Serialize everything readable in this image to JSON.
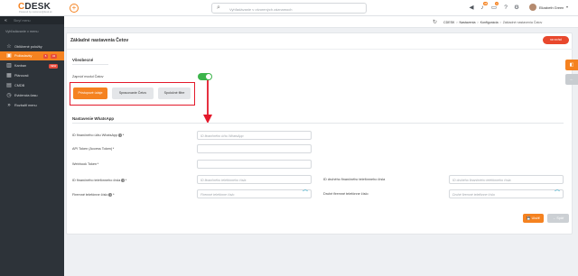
{
  "header": {
    "logo_text": "DESK",
    "logo_c": "C",
    "logo_sub": "Powered by customer@desk.sk",
    "plus_glyph": "+",
    "search_placeholder": "Vyhľadávanie v otvorených záznamoch",
    "icons": [
      {
        "name": "megaphone-icon",
        "glyph": "📢",
        "badge": ""
      },
      {
        "name": "bell-icon",
        "glyph": "🔔",
        "badge": "38"
      },
      {
        "name": "chat-icon",
        "glyph": "💬",
        "badge": "4"
      },
      {
        "name": "question-icon",
        "glyph": "?",
        "badge": ""
      },
      {
        "name": "gear-icon",
        "glyph": "⚙",
        "badge": ""
      }
    ],
    "username": "Elizabeth Green",
    "caret": "▾"
  },
  "sidebar": {
    "collapse_label": "Skryť menu",
    "search_label": "Vyhľadávanie v menu",
    "items": [
      {
        "label": "Obľúbené položky",
        "icon": "star-icon",
        "glyph": "☆",
        "badge": "",
        "badge2": "",
        "active": false
      },
      {
        "label": "Požiadavky",
        "icon": "tickets-icon",
        "glyph": "▣",
        "badge": "5",
        "badge2": "34",
        "active": true
      },
      {
        "label": "Kanban",
        "icon": "kanban-icon",
        "glyph": "▥",
        "badge": "NEW",
        "badge2": "",
        "active": false
      },
      {
        "label": "Plánovač",
        "icon": "calendar-icon",
        "glyph": "▦",
        "badge": "",
        "badge2": "",
        "active": false
      },
      {
        "label": "CMDB",
        "icon": "cmdb-icon",
        "glyph": "▤",
        "badge": "",
        "badge2": "",
        "active": false
      },
      {
        "label": "Evidencia času",
        "icon": "clock-icon",
        "glyph": "◷",
        "badge": "",
        "badge2": "",
        "active": false
      },
      {
        "label": "Rozbaliť menu",
        "icon": "expand-icon",
        "glyph": "»",
        "badge": "",
        "badge2": "",
        "active": false
      }
    ]
  },
  "breadcrumb": {
    "refresh_glyph": "↻",
    "items": [
      "CDESK",
      "Nastavenia",
      "Konfigurácia",
      "Základné nastavenia Čatov"
    ],
    "separator": ">"
  },
  "main": {
    "title": "Základné nastavenia Četov",
    "pill_label": "na vrchol",
    "general_section": "Všeobecné",
    "enable_label": "Zapnúť modul Čatov",
    "toggle_on": true,
    "tabs": [
      "Prístupové údaje",
      "Spracovanie Četov",
      "Spoločné filtre"
    ],
    "whatsapp_section": "Nastavenie WhatsApp",
    "fields": {
      "account_id": {
        "label": "ID finančného účtu WhatsApp",
        "placeholder": "ID finančného účtu WhatsApp"
      },
      "api_token": {
        "label": "API Token (Access Token)",
        "placeholder": ""
      },
      "webhook_token": {
        "label": "Webhook Token",
        "placeholder": ""
      },
      "phone_id_1": {
        "label": "ID finančného telefónneho čísla",
        "placeholder": "ID finančného telefónneho čísla"
      },
      "phone_id_2": {
        "label": "ID druhého finančného telefónneho čísla",
        "placeholder": "ID druhého finančného telefónneho čísla"
      },
      "phone_1": {
        "label": "Firemné telefónne číslo",
        "placeholder": "Firemné telefónne číslo"
      },
      "phone_2": {
        "label": "Druhé firemné telefónne číslo",
        "placeholder": "Druhé firemné telefónne číslo"
      }
    },
    "required_mark": "*",
    "info_glyph": "i",
    "save_label": "Uložiť",
    "back_label": "Späť"
  },
  "side_tabs": [
    {
      "name": "help-side-tab",
      "glyph": "◧",
      "color": "#f58220"
    },
    {
      "name": "back-side-tab",
      "glyph": "←",
      "color": "#c8ccd0"
    }
  ],
  "colors": {
    "accent": "#f58220",
    "highlight": "#e3192b",
    "toggle": "#3cb44b"
  }
}
